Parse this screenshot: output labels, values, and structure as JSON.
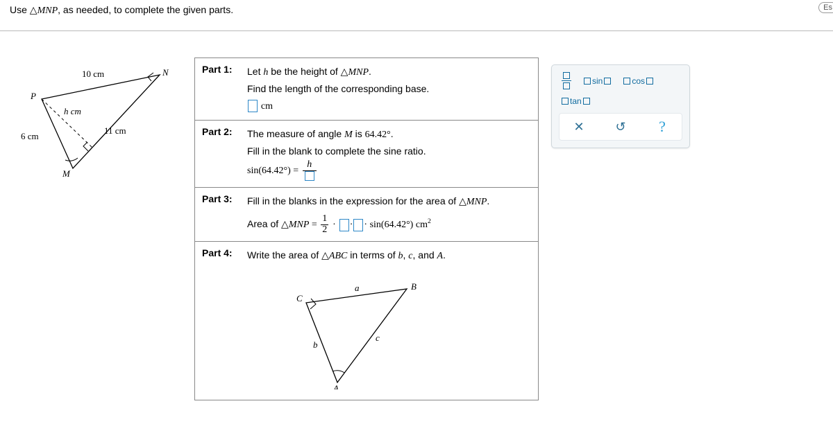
{
  "instruction_prefix": "Use ",
  "instruction_triangle": "△",
  "instruction_tri_name": "MNP",
  "instruction_suffix": ", as needed, to complete the given parts.",
  "diagram": {
    "P": "P",
    "N": "N",
    "M": "M",
    "side_PN": "10 cm",
    "side_PM": "6 cm",
    "side_MN": "11 cm",
    "height": "h cm"
  },
  "parts": {
    "p1": {
      "label": "Part 1:",
      "line1a": "Let ",
      "line1_h": "h",
      "line1b": " be the height of ",
      "line1_tri": "△",
      "line1_name": "MNP",
      "line1_end": ".",
      "line2": "Find the length of the corresponding base.",
      "unit": "cm"
    },
    "p2": {
      "label": "Part 2:",
      "line1a": "The measure of angle ",
      "line1_M": "M",
      "line1b": " is ",
      "line1_val": "64.42°",
      "line1_end": ".",
      "line2": "Fill in the blank to complete the sine ratio.",
      "sin_label": "sin",
      "sin_arg": "(64.42°)",
      "equals": " = ",
      "frac_num": "h"
    },
    "p3": {
      "label": "Part 3:",
      "line1a": "Fill in the blanks in the expression for the area of ",
      "line1_tri": "△",
      "line1_name": "MNP",
      "line1_end": ".",
      "area_prefix": "Area of ",
      "area_tri": "△",
      "area_name": "MNP",
      "equals": " = ",
      "half_num": "1",
      "half_den": "2",
      "dot": "·",
      "sin_label": " sin",
      "sin_arg": "(64.42°)",
      "unit": " cm",
      "sup": "2"
    },
    "p4": {
      "label": "Part 4:",
      "line1a": "Write the area of ",
      "line1_tri": "△",
      "line1_name": "ABC",
      "line1b": " in terms of ",
      "b": "b",
      "comma1": ", ",
      "c": "c",
      "comma2": ", and ",
      "A": "A",
      "end": ".",
      "diagram": {
        "A": "A",
        "B": "B",
        "C": "C",
        "a": "a",
        "b": "b",
        "c": "c"
      }
    }
  },
  "palette": {
    "sin": "sin",
    "cos": "cos",
    "tan": "tan",
    "close": "✕",
    "undo": "↺",
    "help": "?"
  },
  "es_badge": "Es"
}
